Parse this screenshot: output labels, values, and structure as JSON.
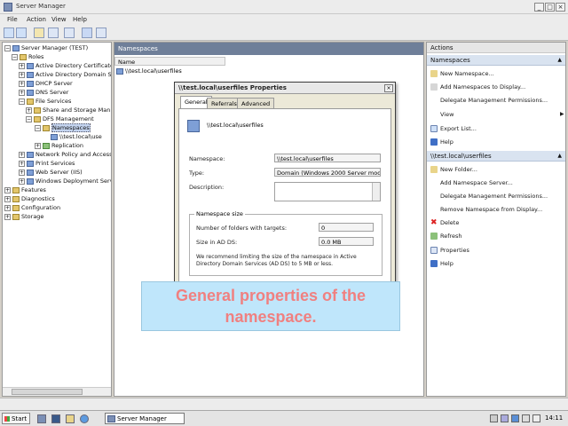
{
  "window": {
    "title": "Server Manager"
  },
  "menu": [
    "File",
    "Action",
    "View",
    "Help"
  ],
  "tree": {
    "nodes": [
      {
        "label": "Server Manager (TEST)",
        "expander": "−"
      },
      {
        "label": "Roles",
        "expander": "−"
      },
      {
        "label": "Active Directory Certificate",
        "expander": "+"
      },
      {
        "label": "Active Directory Domain Se",
        "expander": "+"
      },
      {
        "label": "DHCP Server",
        "expander": "+"
      },
      {
        "label": "DNS Server",
        "expander": "+"
      },
      {
        "label": "File Services",
        "expander": "−"
      },
      {
        "label": "Share and Storage Man",
        "expander": "+"
      },
      {
        "label": "DFS Management",
        "expander": "−"
      },
      {
        "label": "Namespaces",
        "expander": "−"
      },
      {
        "label": "\\\\test.local\\use",
        "expander": ""
      },
      {
        "label": "Replication",
        "expander": "+"
      },
      {
        "label": "Network Policy and Access",
        "expander": "+"
      },
      {
        "label": "Print Services",
        "expander": "+"
      },
      {
        "label": "Web Server (IIS)",
        "expander": "+"
      },
      {
        "label": "Windows Deployment Servi",
        "expander": "+"
      },
      {
        "label": "Features",
        "expander": "+"
      },
      {
        "label": "Diagnostics",
        "expander": "+"
      },
      {
        "label": "Configuration",
        "expander": "+"
      },
      {
        "label": "Storage",
        "expander": "+"
      }
    ]
  },
  "center": {
    "header": "Namespaces",
    "column": "Name",
    "rows": [
      "\\\\test.local\\userfiles"
    ]
  },
  "actions": {
    "header": "Actions",
    "section1": {
      "title": "Namespaces",
      "items": [
        "New Namespace...",
        "Add Namespaces to Display...",
        "Delegate Management Permissions...",
        "View",
        "Export List...",
        "Help"
      ]
    },
    "section2": {
      "title": "\\\\test.local\\userfiles",
      "items": [
        "New Folder...",
        "Add Namespace Server...",
        "Delegate Management Permissions...",
        "Remove Namespace from Display...",
        "Delete",
        "Refresh",
        "Properties",
        "Help"
      ]
    }
  },
  "dialog": {
    "title": "\\\\test.local\\userfiles Properties",
    "close": "×",
    "tabs": [
      "General",
      "Referrals",
      "Advanced"
    ],
    "name": "\\\\test.local\\userfiles",
    "namespace_label": "Namespace:",
    "namespace_value": "\\\\test.local\\userfiles",
    "type_label": "Type:",
    "type_value": "Domain (Windows 2000 Server mode)",
    "description_label": "Description:",
    "group_title": "Namespace size",
    "folders_label": "Number of folders with targets:",
    "folders_value": "0",
    "size_label": "Size in AD DS:",
    "size_value": "0.0 MB",
    "note": "We recommend limiting the size of the namespace in Active Directory Domain Services (AD DS) to 5 MB or less."
  },
  "caption": "General properties of the namespace.",
  "taskbar": {
    "start": "Start",
    "task": "Server Manager",
    "clock": "14:11"
  },
  "colors": {
    "panel_header": "#6f7f99",
    "caption_bg": "#bfe6fb",
    "caption_text": "#f08080"
  }
}
